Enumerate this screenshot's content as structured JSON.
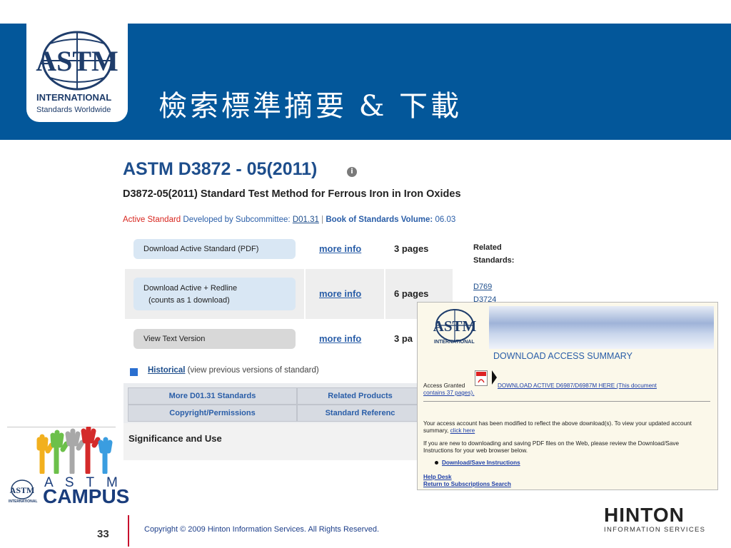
{
  "slide": {
    "title": "檢索標準摘要 & 下載",
    "page_number": "33",
    "copyright": "Copyright © 2009 Hinton Information Services. All Rights Reserved."
  },
  "astm_logo": {
    "name": "INTERNATIONAL",
    "tagline": "Standards Worldwide"
  },
  "standard": {
    "title": "ASTM D3872 - 05(2011)",
    "subtitle": "D3872-05(2011) Standard Test Method for Ferrous Iron in Iron Oxides",
    "status": "Active Standard",
    "developed_by": "Developed by Subcommittee:",
    "subcommittee": "D01.31",
    "separator": "|",
    "volume_label": "Book of Standards Volume:",
    "volume": "06.03"
  },
  "downloads": [
    {
      "label": "Download Active Standard (PDF)",
      "more": "more info",
      "pages": "3 pages"
    },
    {
      "label_line1": "Download Active + Redline",
      "label_line2": "(counts as 1 download)",
      "more": "more info",
      "pages": "6 pages"
    },
    {
      "label": "View Text Version",
      "more": "more info",
      "pages": "3 pa"
    }
  ],
  "related": {
    "label_line1": "Related",
    "label_line2": "Standards:",
    "links": [
      "D769",
      "D3724"
    ]
  },
  "historical": {
    "link": "Historical",
    "note": "(view previous versions of standard)"
  },
  "tabs": {
    "more_standards": "More D01.31 Standards",
    "related_products": "Related Products",
    "copyright": "Copyright/Permissions",
    "standard_reference": "Standard Referenc"
  },
  "significance": "Significance and Use",
  "popup": {
    "logo_name": "INTERNATIONAL",
    "heading": "DOWNLOAD ACCESS SUMMARY",
    "access_granted": "Access Granted",
    "download_link_1": "DOWNLOAD ACTIVE D6987/D6987M HERE (This document",
    "download_link_2": "contains 37 pages).",
    "account_text_1": "Your access account has been modified to reflect the above download(s). To view your updated account",
    "account_text_2": "summary,",
    "click_here": "click here",
    "new_user_text_1": "If you are new to downloading and saving PDF files on the Web, please review the Download/Save",
    "new_user_text_2": "Instructions for your web browser below.",
    "instructions_link": "Download/Save Instructions",
    "help_desk": "Help Desk",
    "return_link": "Return to Subscriptions Search"
  },
  "campus": {
    "letters": "A S T M",
    "word": "CAMPUS",
    "logo_name": "INTERNATIONAL"
  },
  "hinton": {
    "name": "HINTON",
    "sub": "INFORMATION SERVICES"
  }
}
